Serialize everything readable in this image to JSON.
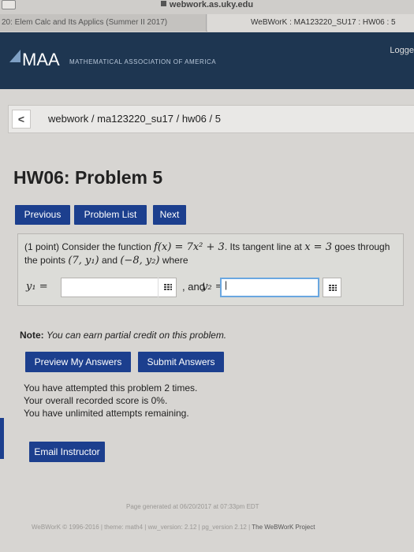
{
  "browser": {
    "url": "webwork.as.uky.edu",
    "tab_left": "20: Elem Calc and Its Applics (Summer II 2017)",
    "tab_right": "WeBWorK : MA123220_SU17 : HW06 : 5"
  },
  "header": {
    "logo": "MAA",
    "subtitle": "MATHEMATICAL ASSOCIATION OF AMERICA",
    "logged_in": "Logge"
  },
  "breadcrumb": {
    "back_symbol": "<",
    "path": "webwork / ma123220_su17 / hw06 / 5"
  },
  "page": {
    "title": "HW06: Problem 5"
  },
  "nav": {
    "previous": "Previous",
    "problem_list": "Problem List",
    "next": "Next"
  },
  "problem": {
    "points": "(1 point)",
    "text_1": "Consider the function",
    "func": "f(x) = 7x² + 3",
    "text_2": ". Its tangent line at",
    "at": "x = 3",
    "text_3": "goes through the points",
    "p1": "(7, y₁)",
    "and": "and",
    "p2": "(−8, y₂)",
    "where": "where",
    "y1_label": "y₁ =",
    "and_sep": ", and",
    "y2_label": "y₂ =",
    "y1_value": "",
    "y2_value": "|"
  },
  "note": {
    "label": "Note:",
    "text": "You can earn partial credit on this problem."
  },
  "submit": {
    "preview": "Preview My Answers",
    "submit": "Submit Answers"
  },
  "attempts": {
    "line1": "You have attempted this problem 2 times.",
    "line2": "Your overall recorded score is 0%.",
    "line3": "You have unlimited attempts remaining."
  },
  "email": {
    "label": "Email Instructor"
  },
  "footer": {
    "generated": "Page generated at 06/20/2017 at 07:33pm EDT",
    "copyright": "WeBWorK © 1996-2016 | theme: math4 | ww_version: 2.12 | pg_version 2.12 |",
    "project": "The WeBWorK Project"
  }
}
